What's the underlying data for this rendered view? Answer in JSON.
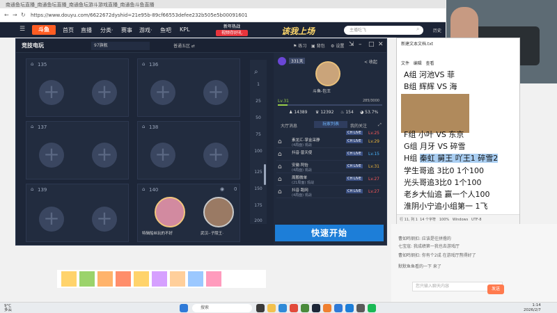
{
  "browser": {
    "tabs": "南通鱼坛直播_南通鱼坛直播_南通鱼坛游斗游戏直播_南通鱼斗鱼直播",
    "address": "https://www.douyu.com/6622672dyshid=21e95b-89cf66553defee232b505e5b00091601"
  },
  "site": {
    "logo": "斗鱼",
    "nav": [
      "首页",
      "直播",
      "分类·",
      "赛事",
      "游戏·",
      "鱼吧",
      "KPL"
    ],
    "hot_top": "新年热战",
    "hot_bottom": "视频存好礼",
    "banner": "该我上场",
    "search_placeholder": "主播吃飞",
    "right_icons": [
      "历史"
    ]
  },
  "app": {
    "logo": "竞技电玩",
    "room_id": "97旗舰",
    "room_mode": "普通五区 ⇄",
    "toolbar": [
      "练习",
      "背包",
      "设置"
    ],
    "slots": [
      {
        "num": "135"
      },
      {
        "num": "136"
      },
      {
        "num": "137"
      },
      {
        "num": "138"
      },
      {
        "num": "139"
      },
      {
        "num": "140",
        "count": "0"
      }
    ],
    "players": [
      {
        "name": "特辑船丝玩的不好"
      },
      {
        "name": "武汉-·子陵王·"
      }
    ],
    "pager": [
      "1",
      "25",
      "50",
      "75",
      "100",
      "125",
      "150",
      "175",
      "200"
    ],
    "profile": {
      "level_badge": "331天",
      "collapse": "< 收起",
      "name": "斗鱼-包王",
      "level": "Lv.31",
      "xp": "285/3000",
      "xp_fraction": 0.095,
      "stats": [
        "14389",
        "12392",
        "154",
        "53.7%"
      ]
    },
    "right_tabs": [
      "大厅消息",
      "玩家列表",
      "我的关注"
    ],
    "rooms": [
      {
        "title": "素龙汇-掌金采静",
        "sub": "(4局面) 观战",
        "lv": "Lv.29",
        "color": "#f0b73a"
      },
      {
        "title": "抖音·曾天使",
        "sub": "",
        "lv": "Lv.15",
        "color": "#4ab6ff"
      },
      {
        "title": "安徽·阿怡",
        "sub": "(4局面) 观战",
        "lv": "Lv.31",
        "color": "#f0b73a"
      },
      {
        "title": "周鹏微单",
        "sub": "(21局面) 观战",
        "lv": "Lv.27",
        "color": "#ff5a5a"
      },
      {
        "title": "抖音·跑网",
        "sub": "(4局面) 观战",
        "lv": "Lv.27",
        "color": "#ff5a5a"
      }
    ],
    "top_lv": "Lv.25",
    "live_badge": "CH LIVE",
    "quick_start": "快速开始"
  },
  "notepad": {
    "title": "新建文本文档.txt",
    "menu": [
      "文件",
      "编辑",
      "查看"
    ],
    "lines": [
      "A组 河池VS 菲",
      "B组 辉辉 VS 海",
      "F组 小叶 VS 东京",
      "G组 月牙 VS 碎雪",
      "H组 ",
      "学生哥追 3比0 1个100",
      "光头哥追3比0 1个100",
      "老乡大仙追 赢一个人100",
      "淮阴小宁追小组第一 1飞"
    ],
    "selected": "秦虹 舅王 吖王1 碎雪2",
    "status": [
      "行 11, 列 1",
      "14 个字符",
      "100%",
      "Windows",
      "UTF-8"
    ]
  },
  "chat": {
    "lines": [
      "曹如鸣钢扣: 应该是往拼撸的",
      "七宝寇: 我成绩第一我也去游戏厅",
      "曹如鸣钢扣: 你有个2成 在游戏厅熬得好了",
      "默默鱼鱼看的一下 来了"
    ],
    "input_placeholder": "您只输入聊天内容",
    "send": "发送"
  },
  "taskbar": {
    "weather_temp": "9°C",
    "weather_desc": "多云",
    "search": "搜索",
    "time": "1:14",
    "date": "2026/2/7"
  }
}
